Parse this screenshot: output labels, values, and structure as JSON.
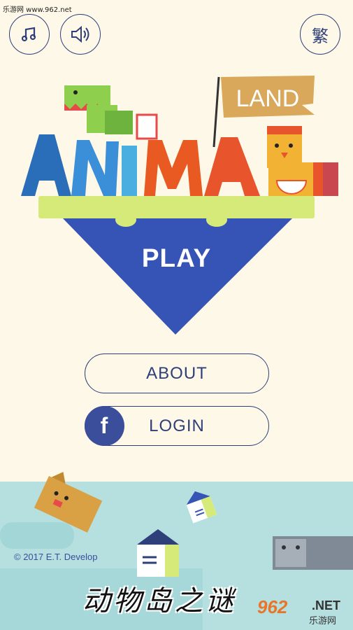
{
  "watermark": {
    "top_text": "乐游网 www.962.net",
    "bottom_brand_num": "962",
    "bottom_brand_net": ".NET",
    "bottom_brand_cn": "乐游网"
  },
  "top_bar": {
    "music_icon": "music-note-icon",
    "sound_icon": "speaker-icon",
    "language_label": "繁"
  },
  "logo": {
    "word_main": "ANIMAL",
    "flag_text": "LAND"
  },
  "menu": {
    "play_label": "PLAY",
    "about_label": "ABOUT",
    "login_label": "LOGIN",
    "facebook_glyph": "f"
  },
  "footer": {
    "copyright": "© 2017 E.T. Develop",
    "caption": "动物岛之谜"
  },
  "colors": {
    "background": "#fdf8e7",
    "outline": "#2f3f7a",
    "play_triangle": "#3554b5",
    "island_grass": "#d6ea7a",
    "sea": "#b5e0df",
    "facebook": "#3b4e9b"
  }
}
